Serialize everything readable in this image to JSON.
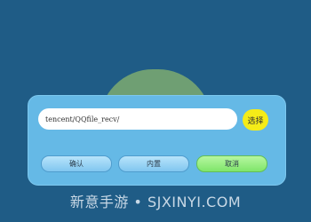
{
  "dialog": {
    "path_value": "tencent/QQfile_recv/",
    "choose_label": "选择",
    "confirm_label": "确认",
    "builtin_label": "内置",
    "cancel_label": "取消"
  },
  "watermark": {
    "text": "新意手游 • SJXINYI.COM"
  },
  "colors": {
    "background": "#1f5c86",
    "panel": "#65b9e6",
    "choose_button": "#f5ec18",
    "cancel_button": "#7fe56a"
  }
}
